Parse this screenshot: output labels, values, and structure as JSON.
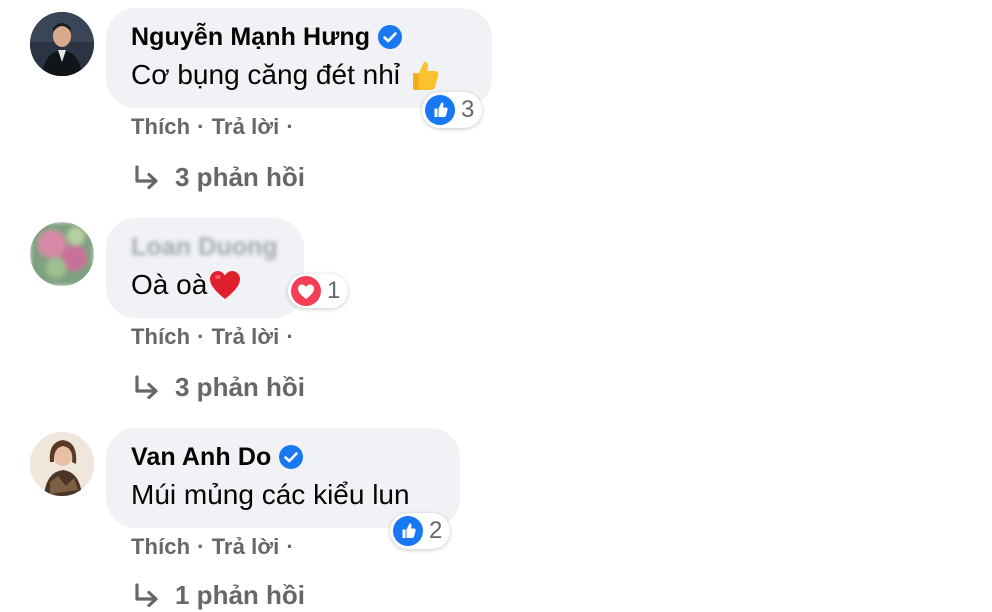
{
  "comments": [
    {
      "author": "Nguyễn Mạnh Hưng",
      "verified": true,
      "text": "Cơ bụng căng đét nhỉ",
      "emoji": "thumbs-up",
      "reaction": {
        "type": "like",
        "count": "3"
      },
      "like_label": "Thích",
      "reply_label": "Trả lời",
      "separator": "·",
      "replies_label": "3 phản hồi"
    },
    {
      "author": "Loan Duong",
      "verified": false,
      "text": "Oà oà",
      "emoji": "red-heart",
      "reaction": {
        "type": "love",
        "count": "1"
      },
      "like_label": "Thích",
      "reply_label": "Trả lời",
      "separator": "·",
      "replies_label": "3 phản hồi"
    },
    {
      "author": "Van Anh Do",
      "verified": true,
      "text": "Múi mủng các kiểu lun",
      "reaction": {
        "type": "like",
        "count": "2"
      },
      "like_label": "Thích",
      "reply_label": "Trả lời",
      "separator": "·",
      "replies_label": "1 phản hồi"
    }
  ],
  "colors": {
    "bubble": "#f0f2f5",
    "secondary_text": "#65676b",
    "verified_blue": "#1877f2",
    "love_red": "#f33e58"
  }
}
